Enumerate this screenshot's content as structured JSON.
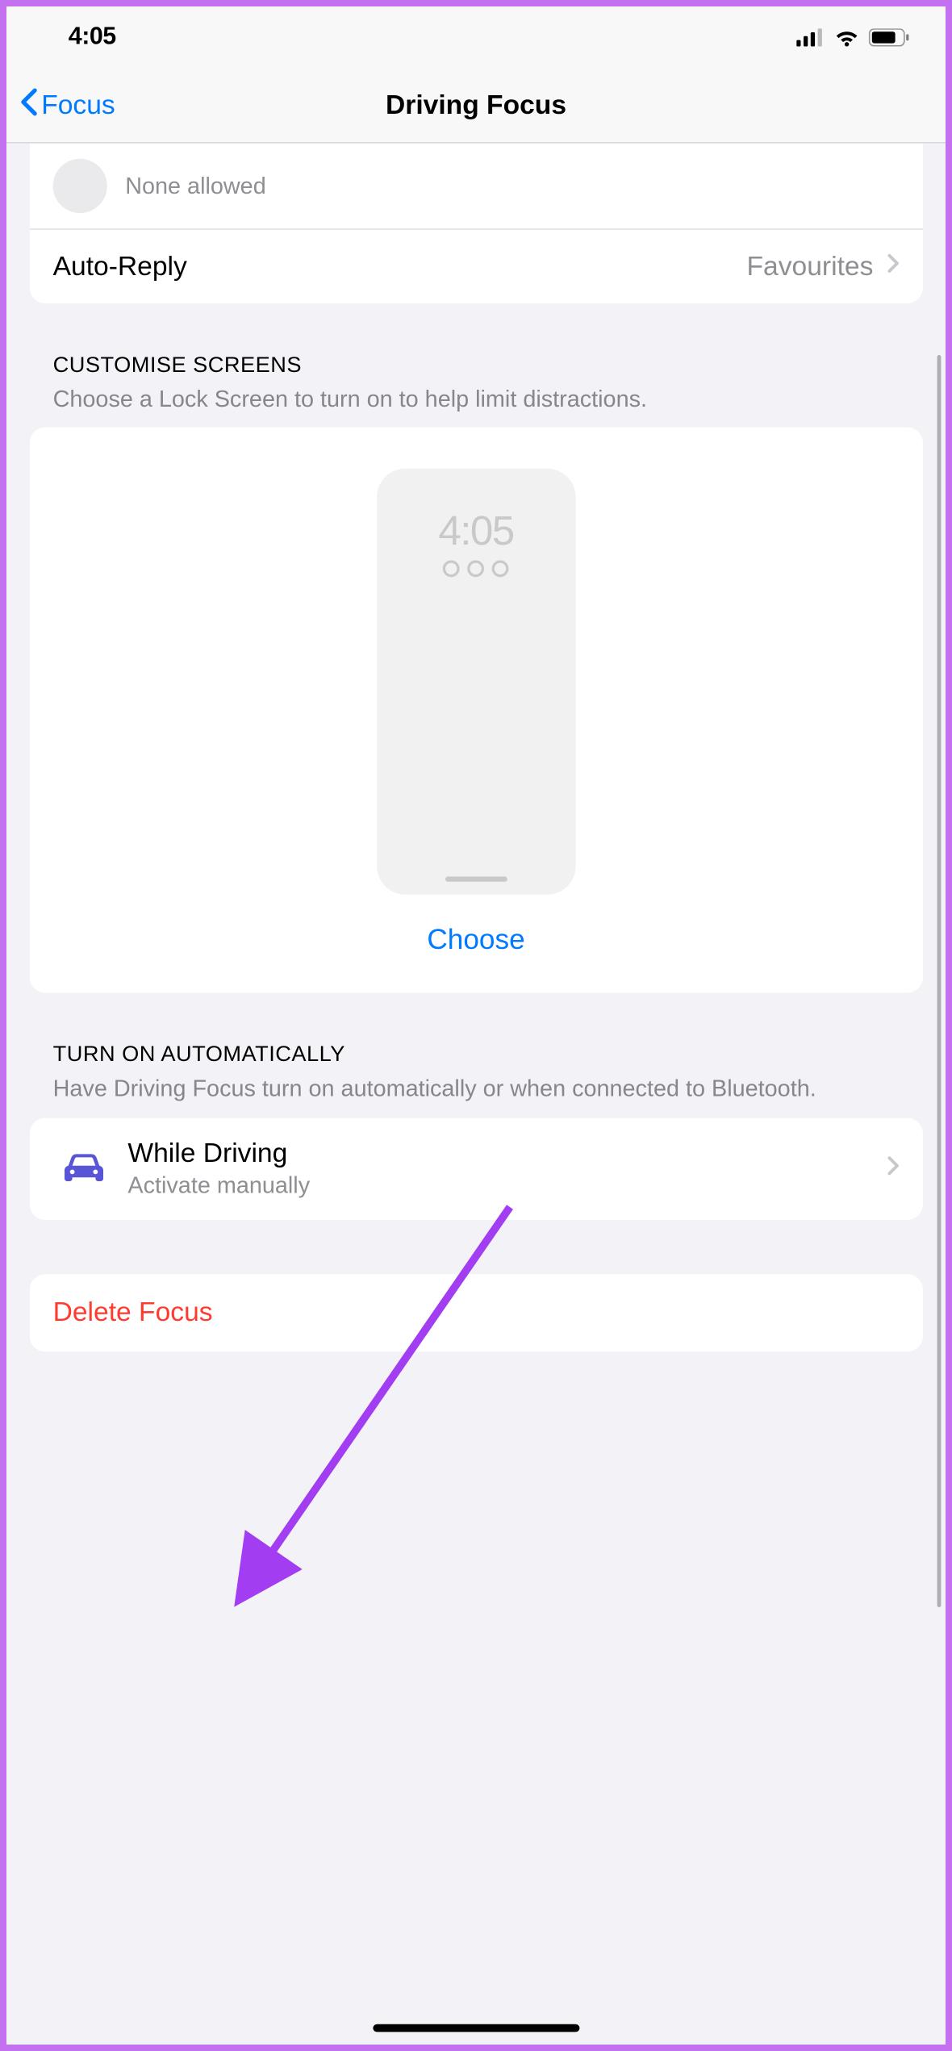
{
  "statusBar": {
    "time": "4:05"
  },
  "nav": {
    "backLabel": "Focus",
    "title": "Driving Focus"
  },
  "allowed": {
    "noneLabel": "None allowed"
  },
  "autoReply": {
    "label": "Auto-Reply",
    "value": "Favourites"
  },
  "customise": {
    "title": "CUSTOMISE SCREENS",
    "desc": "Choose a Lock Screen to turn on to help limit distractions.",
    "previewTime": "4:05",
    "chooseLabel": "Choose"
  },
  "auto": {
    "title": "TURN ON AUTOMATICALLY",
    "desc": "Have Driving Focus turn on automatically or when connected to Bluetooth.",
    "itemTitle": "While Driving",
    "itemSub": "Activate manually"
  },
  "delete": {
    "label": "Delete Focus"
  }
}
